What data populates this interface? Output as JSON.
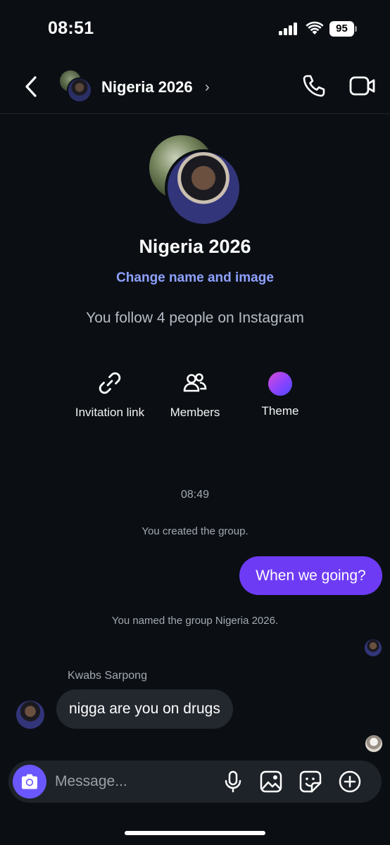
{
  "status_bar": {
    "time": "08:51",
    "battery": "95"
  },
  "header": {
    "title": "Nigeria 2026",
    "chevron": "›"
  },
  "group_info": {
    "name": "Nigeria 2026",
    "change_link": "Change name and image",
    "follow_text": "You follow 4 people on Instagram"
  },
  "actions": [
    {
      "label": "Invitation link",
      "icon": "link-icon"
    },
    {
      "label": "Members",
      "icon": "members-icon"
    },
    {
      "label": "Theme",
      "icon": "theme-swatch-icon"
    }
  ],
  "chat": {
    "timestamp": "08:49",
    "system_created": "You created the group.",
    "outgoing_message": "When we going?",
    "system_named": "You named the group Nigeria 2026.",
    "sender_name": "Kwabs Sarpong",
    "incoming_message": "nigga are you on drugs"
  },
  "composer": {
    "placeholder": "Message..."
  },
  "colors": {
    "background": "#0b0f14",
    "accent_link": "#8ea1ff",
    "outgoing_bubble": "#6e3bf5",
    "incoming_bubble": "#23272e",
    "camera_button": "#6a57ff"
  }
}
